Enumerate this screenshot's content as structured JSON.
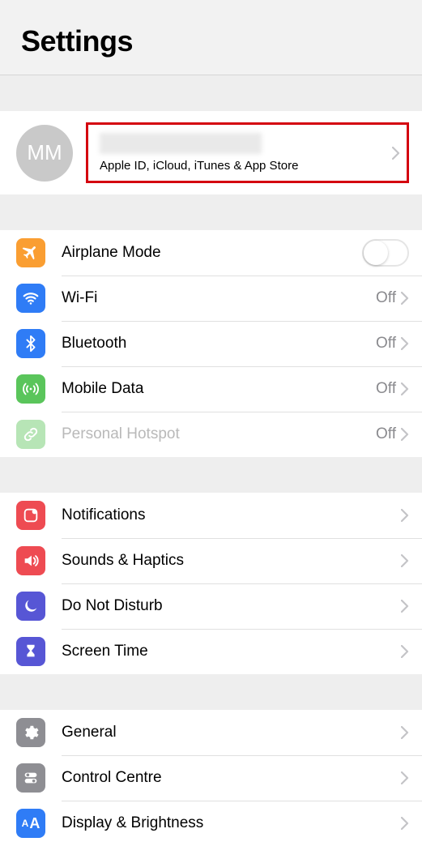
{
  "header": {
    "title": "Settings"
  },
  "account": {
    "initials": "MM",
    "subtitle": "Apple ID, iCloud, iTunes & App Store"
  },
  "group_connect": [
    {
      "key": "airplane",
      "label": "Airplane Mode",
      "type": "toggle",
      "value": ""
    },
    {
      "key": "wifi",
      "label": "Wi-Fi",
      "type": "link",
      "value": "Off"
    },
    {
      "key": "bluetooth",
      "label": "Bluetooth",
      "type": "link",
      "value": "Off"
    },
    {
      "key": "mobile",
      "label": "Mobile Data",
      "type": "link",
      "value": "Off"
    },
    {
      "key": "hotspot",
      "label": "Personal Hotspot",
      "type": "link",
      "value": "Off",
      "dim": true
    }
  ],
  "group_notify": [
    {
      "key": "notifications",
      "label": "Notifications"
    },
    {
      "key": "sounds",
      "label": "Sounds & Haptics"
    },
    {
      "key": "dnd",
      "label": "Do Not Disturb"
    },
    {
      "key": "screentime",
      "label": "Screen Time"
    }
  ],
  "group_general": [
    {
      "key": "general",
      "label": "General"
    },
    {
      "key": "control",
      "label": "Control Centre"
    },
    {
      "key": "display",
      "label": "Display & Brightness"
    }
  ]
}
